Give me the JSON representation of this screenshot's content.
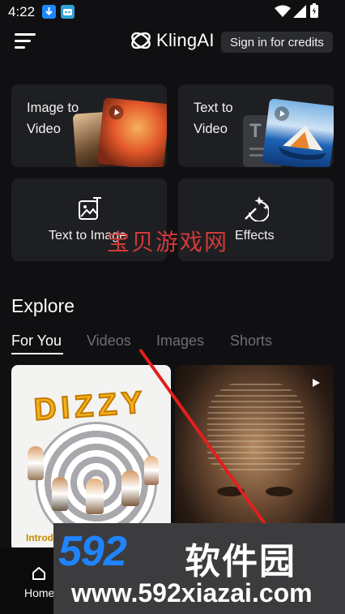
{
  "status_bar": {
    "time": "4:22"
  },
  "header": {
    "brand": "KlingAI",
    "signin_label": "Sign in for credits"
  },
  "cards": [
    {
      "label_line1": "Image to",
      "label_line2": "Video"
    },
    {
      "label_line1": "Text to",
      "label_line2": "Video"
    },
    {
      "label": "Text to Image"
    },
    {
      "label": "Effects"
    }
  ],
  "explore": {
    "title": "Explore",
    "tabs": [
      "For You",
      "Videos",
      "Images",
      "Shorts"
    ],
    "active_tab": "For You"
  },
  "feed": [
    {
      "art_text": "DIZZY",
      "caption_fragment": "Introd"
    },
    {
      "type": "video"
    }
  ],
  "bottom_nav": {
    "home_label": "Home"
  },
  "watermarks": {
    "chinese_overlay": "宝贝游戏网",
    "brand_number": "592",
    "brand_cn": "软件园",
    "url": "www.592xiazai.com"
  },
  "colors": {
    "background": "#101012",
    "card": "#1e1f22",
    "watermark_blue": "#1f84ff",
    "annotation_red": "#e0201e"
  }
}
